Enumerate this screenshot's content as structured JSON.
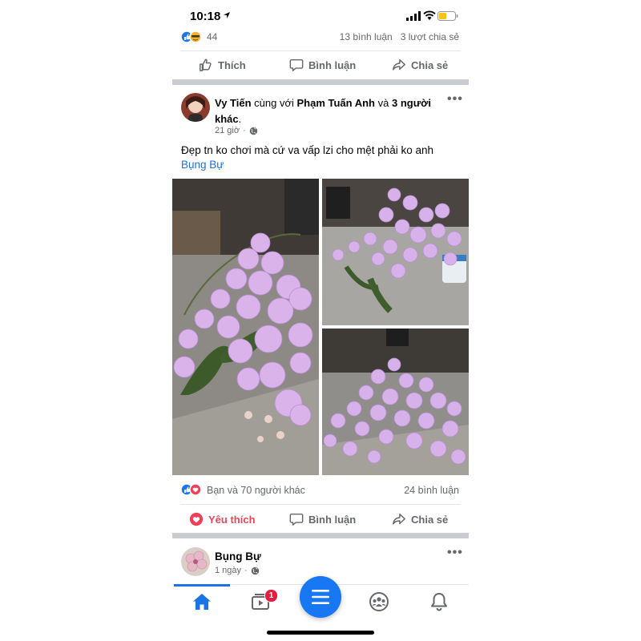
{
  "status_bar": {
    "time": "10:18"
  },
  "previous_post": {
    "reaction_count": "44",
    "comments": "13 bình luận",
    "shares": "3 lượt chia sẻ",
    "actions": {
      "like": "Thích",
      "comment": "Bình luận",
      "share": "Chia sẻ"
    }
  },
  "post": {
    "author": "Vy Tiến",
    "with_text": "cùng với",
    "tagged_person": "Phạm Tuấn Anh",
    "and_text": "và",
    "others": "3 người khác",
    "period": ".",
    "time": "21 giờ",
    "separator": "·",
    "text": "Đẹp tn ko chơi mà cứ va vấp lzi cho mệt phải ko anh",
    "tag": "Bụng Bự",
    "photo_count": 3,
    "reactions_text": "Bạn và 70 người khác",
    "comments": "24 bình luận",
    "actions": {
      "like": "Yêu thích",
      "comment": "Bình luận",
      "share": "Chia sẻ"
    }
  },
  "next_post": {
    "author": "Bụng Bự",
    "time": "1 ngày",
    "separator": "·"
  },
  "tab_bar": {
    "tabs": [
      "home-icon",
      "video-icon",
      "menu-icon",
      "groups-icon",
      "notifications-icon"
    ],
    "video_badge": "1",
    "active_tab": "home"
  },
  "colors": {
    "accent": "#1877f2",
    "love": "#e1485a",
    "secondary_text": "#65676b",
    "badge": "#e41e3f"
  }
}
